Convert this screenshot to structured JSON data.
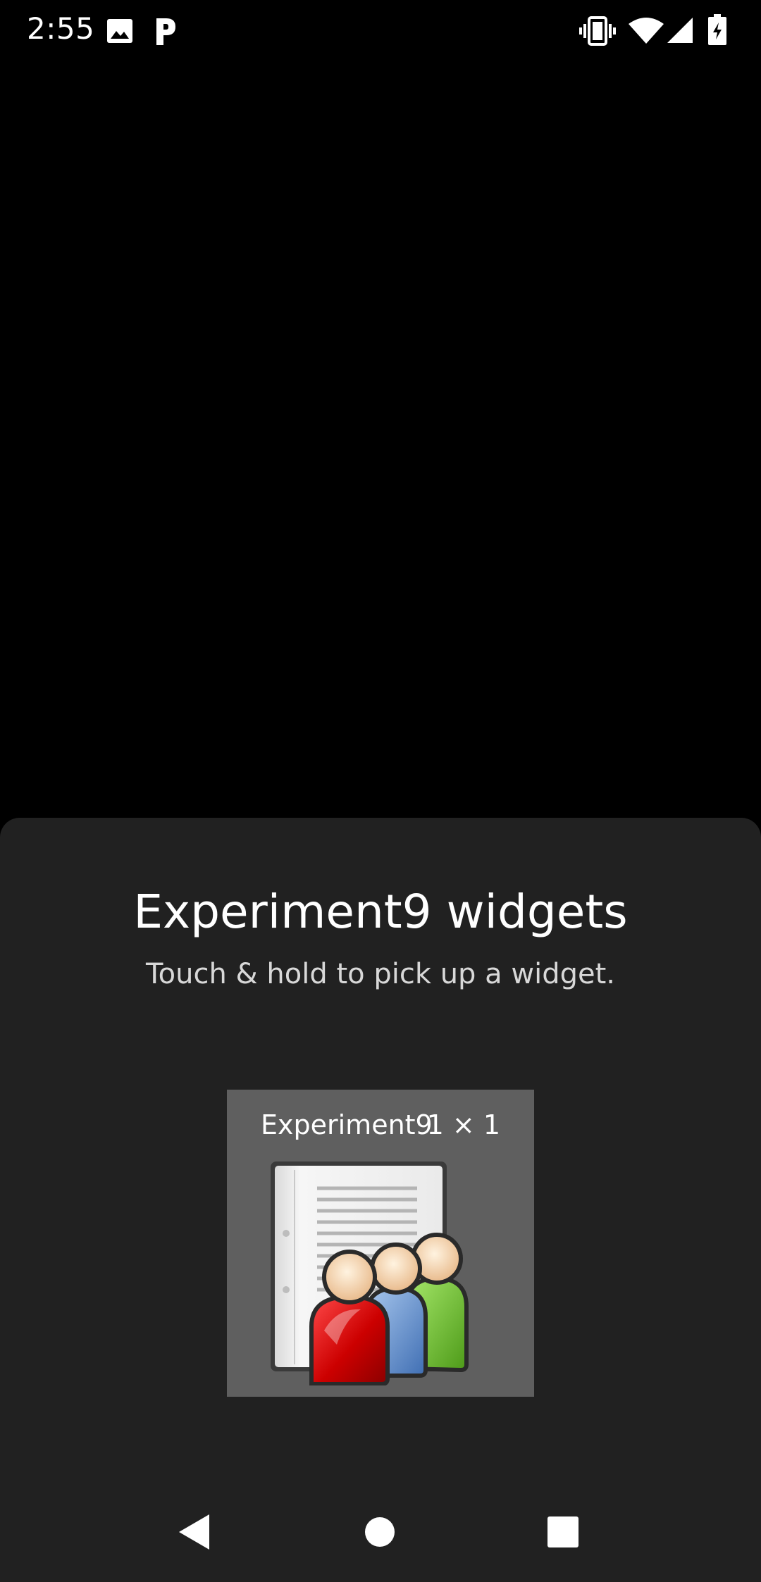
{
  "status_bar": {
    "time": "2:55",
    "left_icons": [
      "image-icon",
      "parking-icon"
    ],
    "right_icons": [
      "vibrate-icon",
      "wifi-icon",
      "signal-icon",
      "battery-charging-icon"
    ]
  },
  "sheet": {
    "title": "Experiment9 widgets",
    "subtitle": "Touch & hold to pick up a widget.",
    "background": "#212121"
  },
  "widgets": [
    {
      "name": "Experiment9",
      "size": "1 × 1",
      "icon": "group-document-icon",
      "background": "#5f5f5f"
    }
  ],
  "nav_bar": {
    "buttons": [
      "back-icon",
      "home-icon",
      "recents-icon"
    ]
  }
}
